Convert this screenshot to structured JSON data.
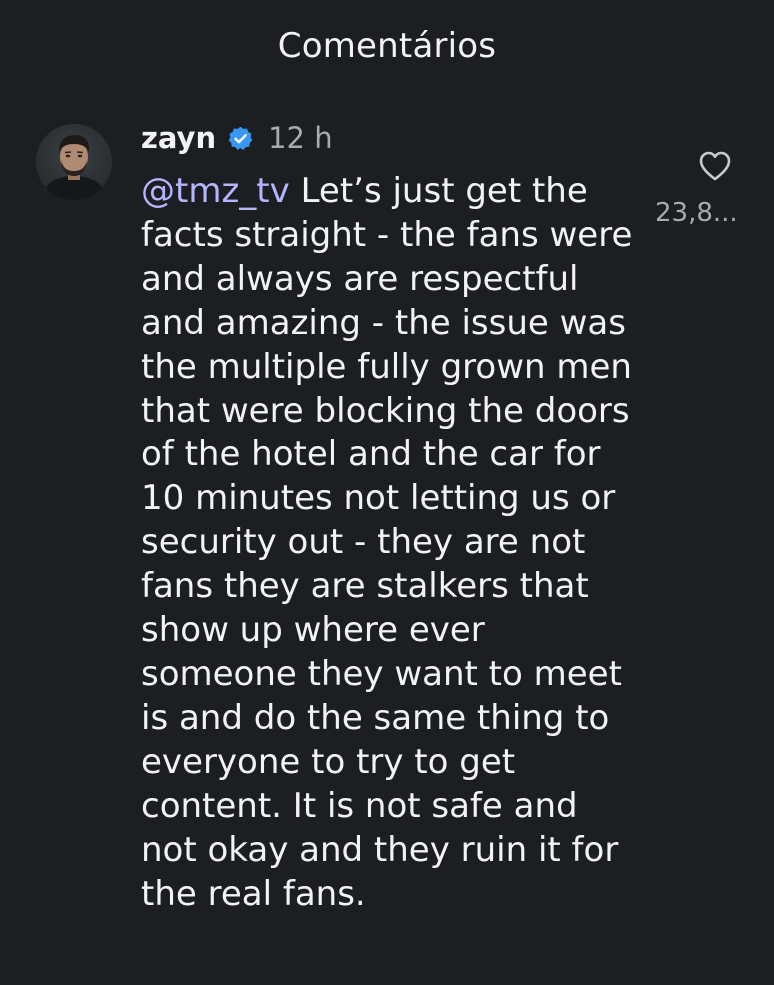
{
  "header": {
    "title": "Comentários"
  },
  "comment": {
    "avatar_icon": "profile-photo",
    "username": "zayn",
    "verified_icon": "verified-badge-icon",
    "verified_color": "#3897f0",
    "time": "12 h",
    "mention": "@tmz_tv",
    "mention_color": "#b5b4ff",
    "text": "Let’s just get the facts straight - the fans were and always are respectful and amazing - the issue was the multiple fully grown men that were blocking the doors of the hotel and the car for 10 minutes not letting us or security out - they are not fans they are stalkers that show up where ever someone they want to meet is and do the same thing to everyone to try to get content. It is not safe and not okay and they ruin it for the real fans.",
    "like_icon": "heart-outline-icon",
    "like_count": "23,8..."
  },
  "colors": {
    "background": "#1c1e22",
    "text_primary": "#f2f3f5",
    "text_secondary": "#a7aab0"
  }
}
